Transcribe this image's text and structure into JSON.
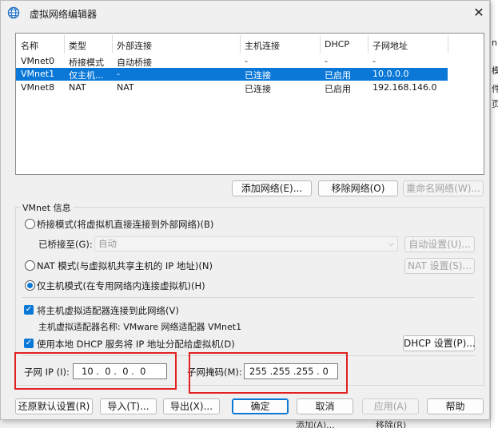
{
  "window": {
    "title": "虚拟网络编辑器",
    "close_glyph": "✕"
  },
  "table": {
    "headers": [
      "名称",
      "类型",
      "外部连接",
      "主机连接",
      "DHCP",
      "子网地址"
    ],
    "rows": [
      [
        "VMnet0",
        "桥接模式",
        "自动桥接",
        "-",
        "-",
        "-"
      ],
      [
        "VMnet1",
        "仅主机...",
        "-",
        "已连接",
        "已启用",
        "10.0.0.0"
      ],
      [
        "VMnet8",
        "NAT",
        "NAT",
        "已连接",
        "已启用",
        "192.168.146.0"
      ]
    ],
    "selected_row": 1
  },
  "table_buttons": {
    "add": "添加网络(E)...",
    "remove": "移除网络(O)",
    "rename": "重命名网络(W)..."
  },
  "vmnet_info": {
    "group_title": "VMnet 信息",
    "bridged_radio": "桥接模式(将虚拟机直接连接到外部网络)(B)",
    "bridged_to_label": "已桥接至(G):",
    "bridged_to_value": "自动",
    "auto_settings": "自动设置(U)...",
    "nat_radio": "NAT 模式(与虚拟机共享主机的 IP 地址)(N)",
    "nat_settings": "NAT 设置(S)...",
    "host_only_radio": "仅主机模式(在专用网络内连接虚拟机)(H)",
    "selected_mode": "host_only",
    "connect_adapter_check": "将主机虚拟适配器连接到此网络(V)",
    "adapter_name_label": "主机虚拟适配器名称: VMware 网络适配器 VMnet1",
    "dhcp_check": "使用本地 DHCP 服务将 IP 地址分配给虚拟机(D)",
    "dhcp_settings": "DHCP 设置(P)...",
    "subnet_ip_label": "子网 IP (I):",
    "subnet_ip_value": "10 .  0 .  0 .  0",
    "subnet_mask_label": "子网掩码(M):",
    "subnet_mask_value": "255 .255 .255 . 0"
  },
  "footer_buttons": {
    "restore": "还原默认设置(R)",
    "import": "导入(T)...",
    "export": "导出(X)...",
    "ok": "确定",
    "cancel": "取消",
    "apply": "应用(A)",
    "help": "帮助"
  },
  "backdrop": {
    "right_chars": [
      "n",
      "模",
      "件",
      "页"
    ],
    "bottom_texts": [
      "添加(A)...",
      "移除(R)"
    ]
  },
  "colors": {
    "accent": "#0b78d7",
    "highlight_box": "#e12020",
    "dialog_bg": "#f0f0f0"
  }
}
